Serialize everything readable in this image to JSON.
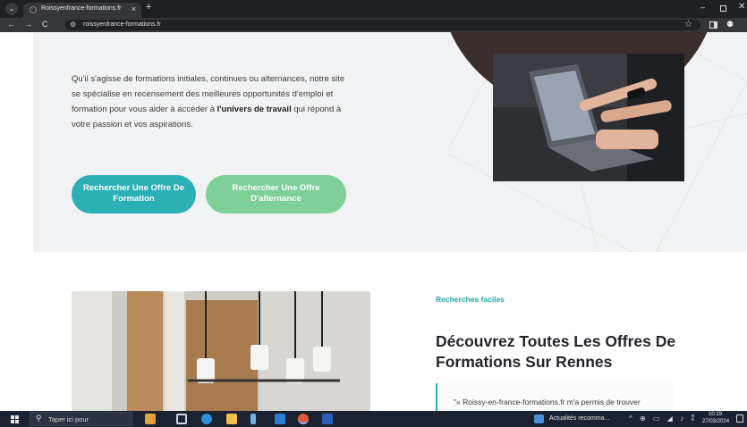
{
  "browser": {
    "tab_title": "Roissyenfrance-formations.fr",
    "tab_close": "×",
    "new_tab": "+",
    "tab_menu": "⌄",
    "window_controls": {
      "minimize": "–",
      "close": "✕"
    },
    "nav": {
      "back": "←",
      "forward": "→",
      "reload": "C"
    },
    "site_info_icon": "⚙",
    "url": "roissyenfrance-formations.fr",
    "bookmark_icon": "☆",
    "profile_icon": "⚉"
  },
  "hero": {
    "intro_before": "Qu'il s'agisse de formations initiales, continues ou alternances, notre site se spécialise en recensement des meilleures opportunités d'emploi et formation pour vous aider à accéder à ",
    "intro_bold": "l'univers de travail",
    "intro_after": " qui répond à votre passion et vos aspirations.",
    "buttons": {
      "formation": "Rechercher Une Offre De Formation",
      "alternance": "Rechercher Une Offre D'alternance"
    },
    "colors": {
      "formation": "#2bb0b6",
      "alternance": "#7fcf99",
      "blob": "#3a2e2c"
    }
  },
  "section": {
    "kicker": "Recherches faciles",
    "title": "Découvrez Toutes Les Offres De Formations Sur Rennes",
    "quote": "\"« Roissy-en-france-formations.fr m'a permis de trouver"
  },
  "taskbar": {
    "search_placeholder": "Taper ici pour",
    "search_icon": "⚲",
    "news": "Actualités recomma...",
    "tray": "^ ⊕ ▭ ◢ ♪ ⁑",
    "time": "10:19",
    "date": "27/03/2024",
    "apps": [
      "explorer-icon",
      "task-view-icon",
      "edge-icon",
      "files-icon",
      "app-icon",
      "mail-icon",
      "chrome-icon",
      "word-icon"
    ]
  }
}
